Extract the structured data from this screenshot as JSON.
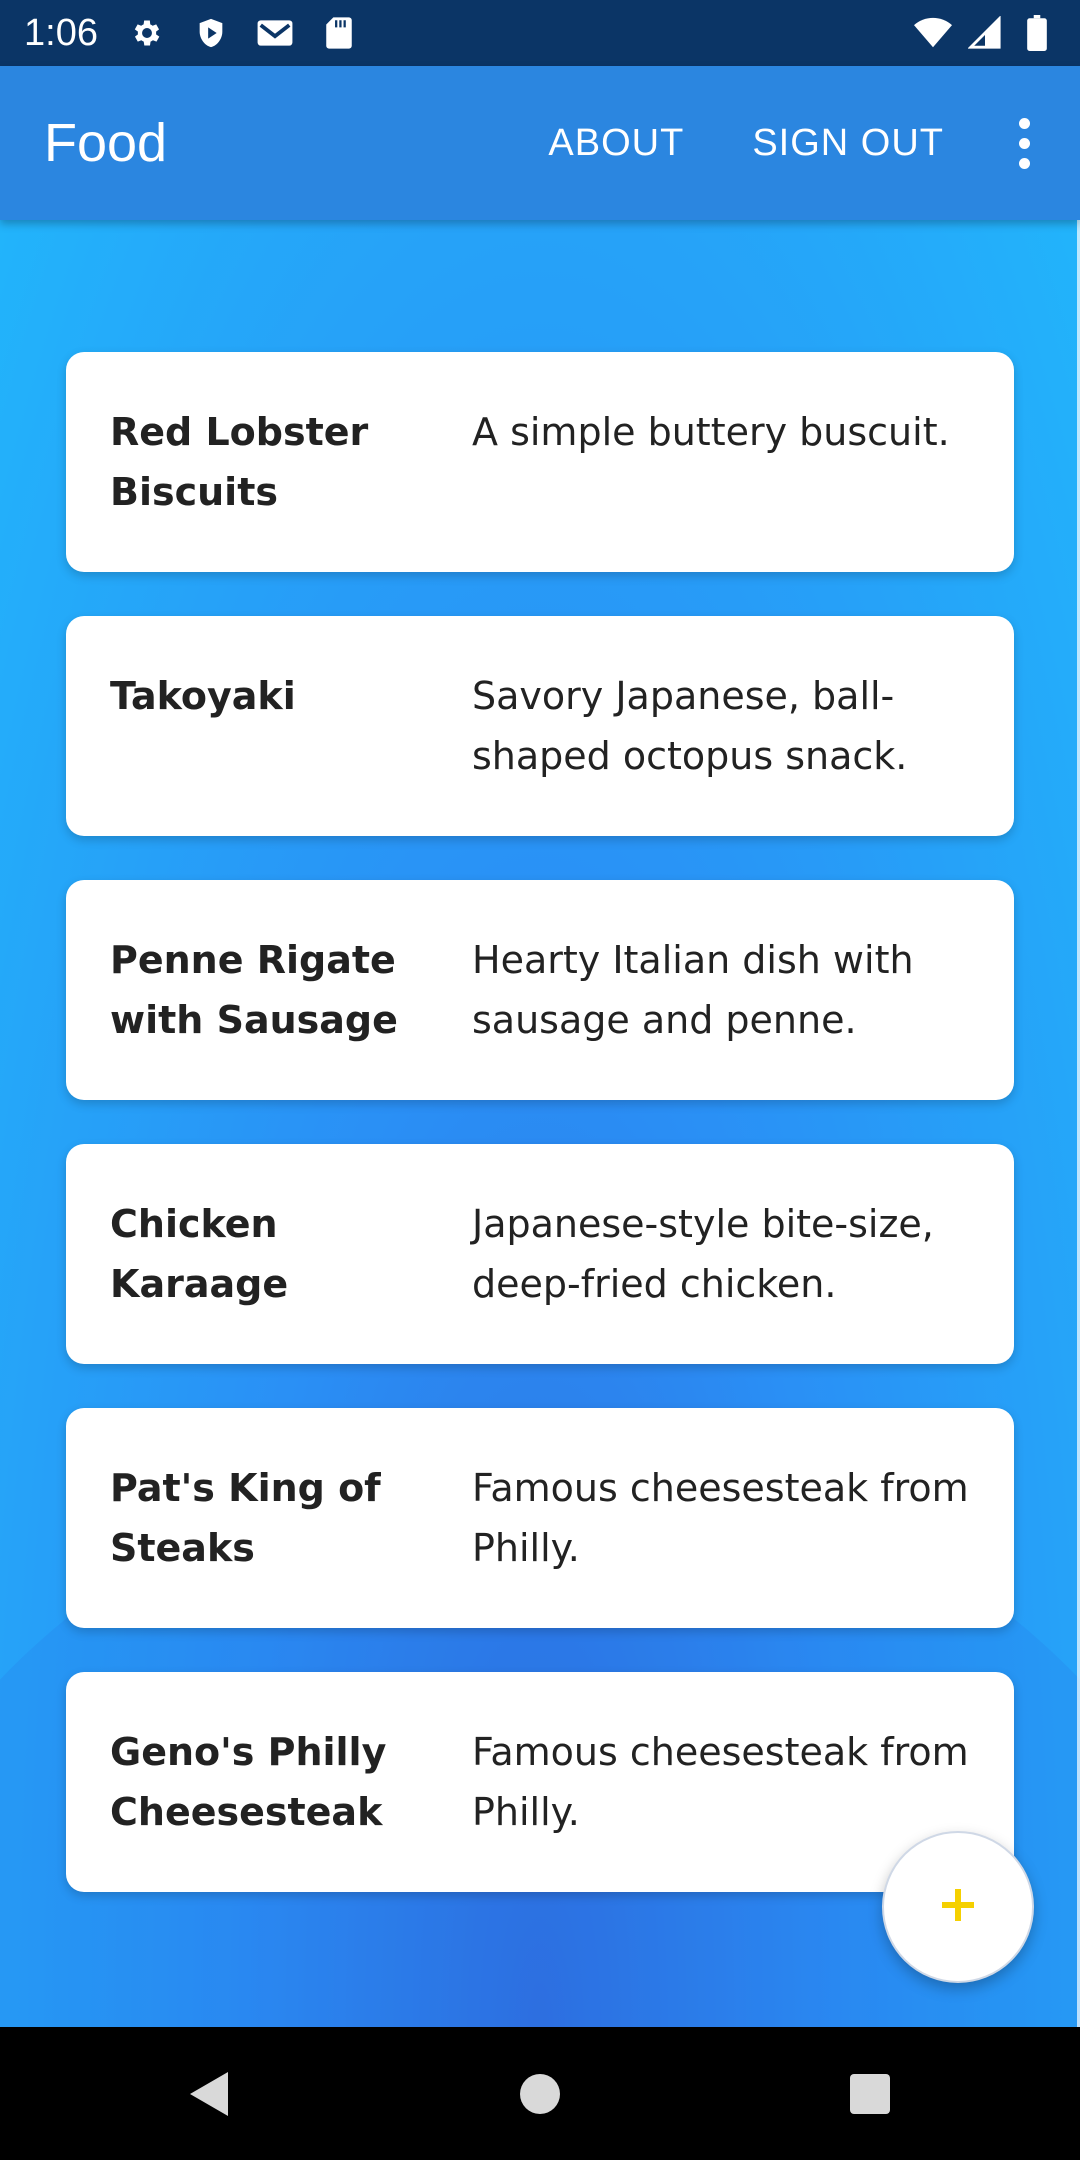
{
  "status_bar": {
    "time": "1:06",
    "icons_left": [
      "gear-icon",
      "shield-play-icon",
      "gmail-icon",
      "sd-card-icon"
    ],
    "icons_right": [
      "wifi-icon",
      "signal-icon",
      "battery-icon"
    ]
  },
  "app_bar": {
    "title": "Food",
    "actions": [
      "ABOUT",
      "SIGN OUT"
    ],
    "overflow_icon": "more-vert-icon",
    "color": "#2b86e0"
  },
  "foods": [
    {
      "name": "Red Lobster Biscuits",
      "description": "A simple buttery buscuit."
    },
    {
      "name": "Takoyaki",
      "description": "Savory Japanese, ball-shaped octopus snack."
    },
    {
      "name": "Penne Rigate with Sausage",
      "description": "Hearty Italian dish with sausage and penne."
    },
    {
      "name": "Chicken Karaage",
      "description": "Japanese-style bite-size, deep-fried chicken."
    },
    {
      "name": "Pat's King of Steaks",
      "description": "Famous cheesesteak from Philly."
    },
    {
      "name": "Geno's Philly Cheesesteak",
      "description": "Famous cheesesteak from Philly."
    }
  ],
  "fab": {
    "icon": "add-icon",
    "icon_color": "#f5d000"
  },
  "nav_bar": {
    "buttons": [
      "back-icon",
      "home-icon",
      "recents-icon"
    ]
  }
}
